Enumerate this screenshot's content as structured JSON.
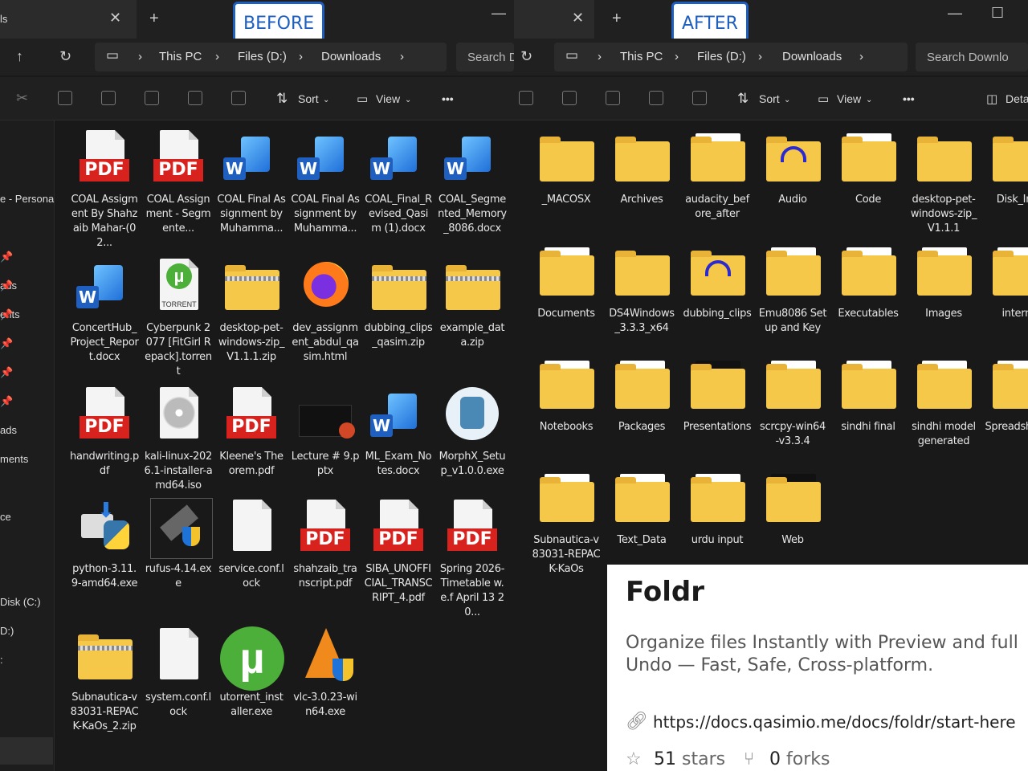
{
  "before": {
    "badge": "BEFORE",
    "tab_title": "ls",
    "breadcrumb": [
      "This PC",
      "Files (D:)",
      "Downloads"
    ],
    "search": "Search D",
    "cmd": {
      "sort": "Sort",
      "view": "View",
      "more": "•••"
    },
    "sidebar": [
      "e - Persona",
      "ads",
      "ents",
      "ads",
      "ments",
      "ce",
      "Disk (C:)",
      "D:)",
      ":"
    ],
    "files": [
      {
        "label": "COAL Assigment By Shahzaib Mahar-(02...",
        "type": "pdf"
      },
      {
        "label": "COAL Assignment - Segmente...",
        "type": "pdf"
      },
      {
        "label": "COAL Final Assignment by Muhamma...",
        "type": "word"
      },
      {
        "label": "COAL Final Assignment by Muhamma...",
        "type": "word"
      },
      {
        "label": "COAL_Final_Revised_Qasim (1).docx",
        "type": "word"
      },
      {
        "label": "COAL_Segmented_Memory_8086.docx",
        "type": "word"
      },
      {
        "label": "ConcertHub_Project_Report.docx",
        "type": "word"
      },
      {
        "label": "Cyberpunk 2077 [FitGirl Repack].torrent",
        "type": "torrent",
        "icon_text": "TORRENT"
      },
      {
        "label": "desktop-pet-windows-zip_V1.1.1.zip",
        "type": "zip"
      },
      {
        "label": "dev_assignment_abdul_qasim.html",
        "type": "firefox"
      },
      {
        "label": "dubbing_clips_qasim.zip",
        "type": "zip"
      },
      {
        "label": "example_data.zip",
        "type": "zip"
      },
      {
        "label": "handwriting.pdf",
        "type": "pdf"
      },
      {
        "label": "kali-linux-2026.1-installer-amd64.iso",
        "type": "iso"
      },
      {
        "label": "Kleene's Theorem.pdf",
        "type": "pdf"
      },
      {
        "label": "Lecture # 9.pptx",
        "type": "pptx"
      },
      {
        "label": "ML_Exam_Notes.docx",
        "type": "word"
      },
      {
        "label": "MorphX_Setup_v1.0.0.exe",
        "type": "app"
      },
      {
        "label": "python-3.11.9-amd64.exe",
        "type": "python"
      },
      {
        "label": "rufus-4.14.exe",
        "type": "usb"
      },
      {
        "label": "service.conf.lock",
        "type": "blank"
      },
      {
        "label": "shahzaib_transcript.pdf",
        "type": "pdf"
      },
      {
        "label": "SIBA_UNOFFICIAL_TRANSCRIPT_4.pdf",
        "type": "pdf"
      },
      {
        "label": "Spring 2026-Timetable w.e.f April 13 20...",
        "type": "pdf"
      },
      {
        "label": "Subnautica-v83031-REPACK-KaOs_2.zip",
        "type": "zip"
      },
      {
        "label": "system.conf.lock",
        "type": "blank"
      },
      {
        "label": "utorrent_installer.exe",
        "type": "utorrent"
      },
      {
        "label": "vlc-3.0.23-win64.exe",
        "type": "vlc"
      }
    ]
  },
  "after": {
    "badge": "AFTER",
    "breadcrumb": [
      "This PC",
      "Files (D:)",
      "Downloads"
    ],
    "search": "Search Downlo",
    "cmd": {
      "sort": "Sort",
      "view": "View",
      "more": "•••",
      "details": "Deta"
    },
    "folders": [
      {
        "label": "_MACOSX",
        "preview": "none"
      },
      {
        "label": "Archives",
        "preview": "none"
      },
      {
        "label": "audacity_before_after",
        "preview": "doc"
      },
      {
        "label": "Audio",
        "preview": "headphones"
      },
      {
        "label": "Code",
        "preview": "doc"
      },
      {
        "label": "desktop-pet-windows-zip_V1.1.1",
        "preview": "none"
      },
      {
        "label": "Disk_Ima",
        "preview": "none"
      },
      {
        "label": "Documents",
        "preview": "doc"
      },
      {
        "label": "DS4Windows_3.3.3_x64",
        "preview": "none"
      },
      {
        "label": "dubbing_clips",
        "preview": "headphones"
      },
      {
        "label": "Emu8086 Setup and Key",
        "preview": "doc"
      },
      {
        "label": "Executables",
        "preview": "doc"
      },
      {
        "label": "Images",
        "preview": "doc"
      },
      {
        "label": "interns",
        "preview": "doc"
      },
      {
        "label": "Notebooks",
        "preview": "doc"
      },
      {
        "label": "Packages",
        "preview": "doc"
      },
      {
        "label": "Presentations",
        "preview": "dark"
      },
      {
        "label": "scrcpy-win64-v3.3.4",
        "preview": "doc"
      },
      {
        "label": "sindhi final",
        "preview": "doc"
      },
      {
        "label": "sindhi model generated",
        "preview": "doc"
      },
      {
        "label": "Spreadsheets",
        "preview": "doc"
      },
      {
        "label": "Subnautica-v83031-REPACK-KaOs",
        "preview": "doc"
      },
      {
        "label": "Text_Data",
        "preview": "doc"
      },
      {
        "label": "urdu input",
        "preview": "doc"
      },
      {
        "label": "Web",
        "preview": "dark"
      }
    ]
  },
  "card": {
    "title": "Foldr",
    "description": "Organize files Instantly with Preview and full Undo — Fast, Safe, Cross-platform.",
    "url": "https://docs.qasimio.me/docs/foldr/start-here",
    "stars": "51",
    "stars_label": "stars",
    "forks": "0",
    "forks_label": "forks"
  }
}
